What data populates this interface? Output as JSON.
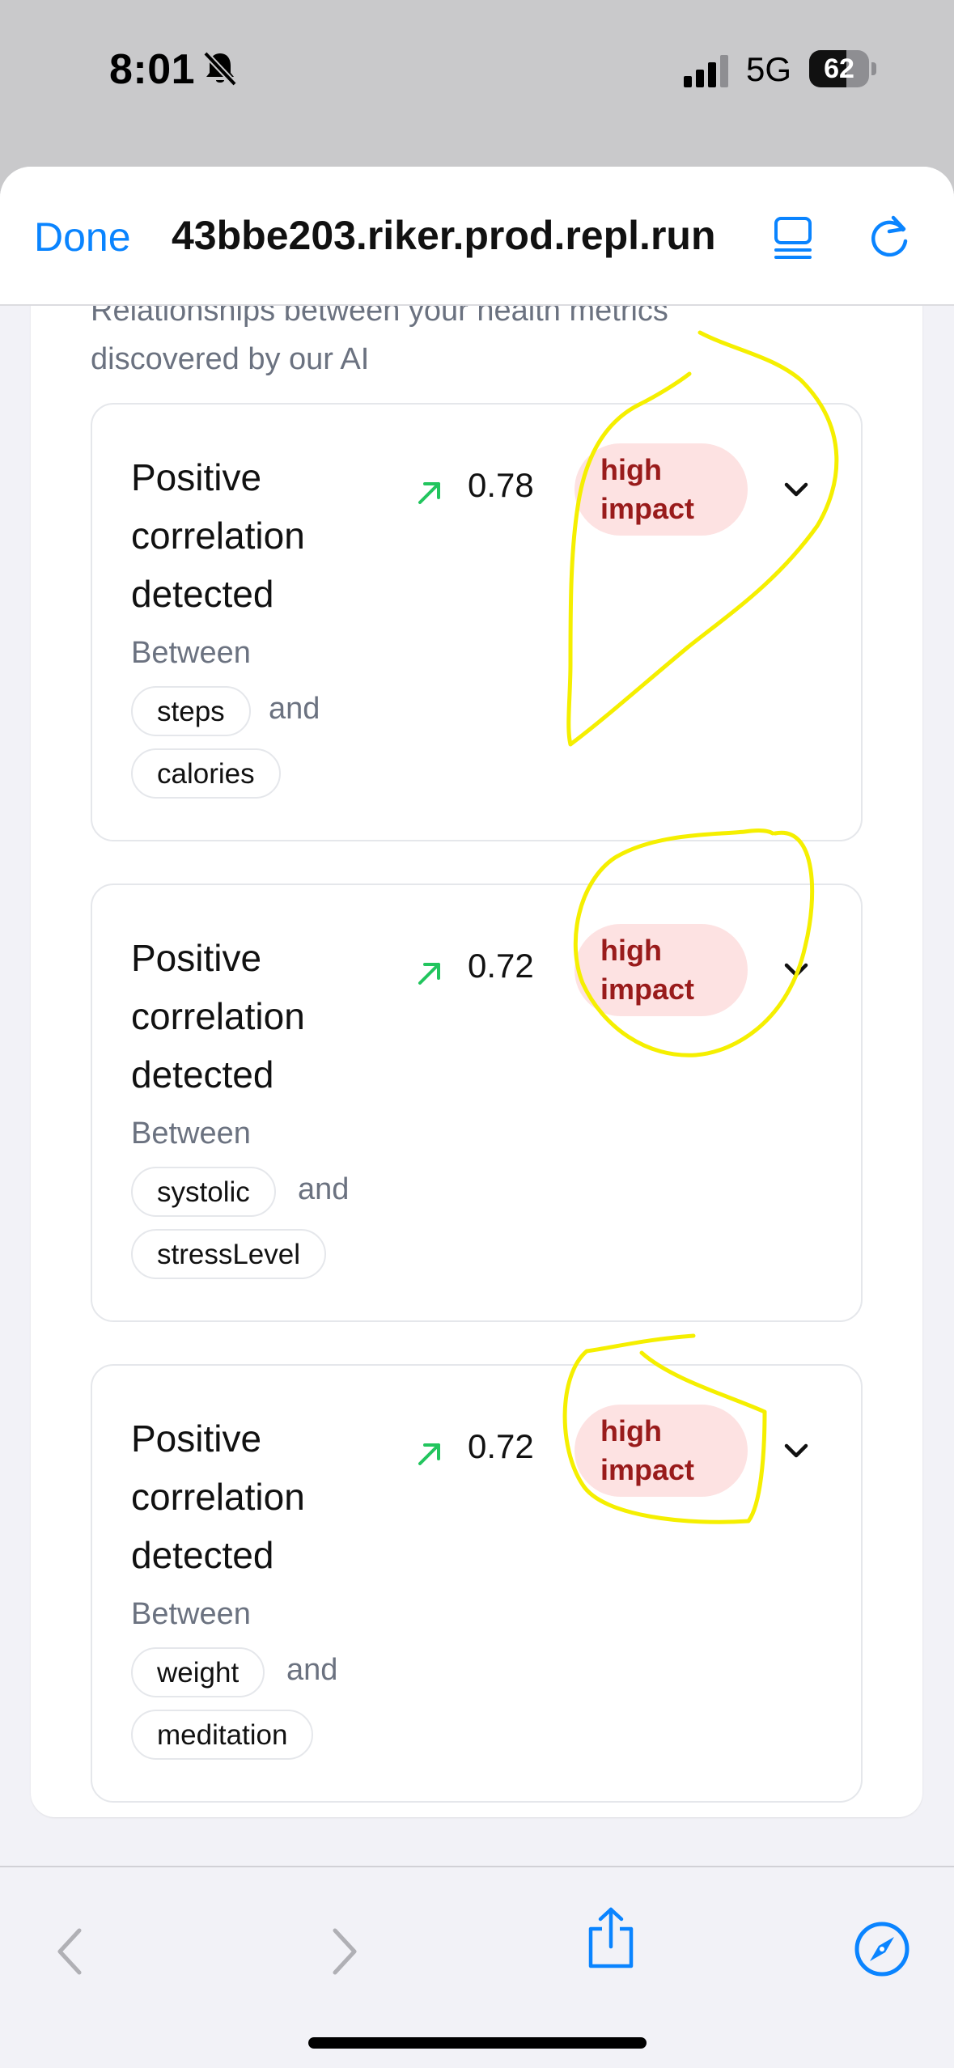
{
  "status_bar": {
    "time": "8:01",
    "network": "5G",
    "battery": "62",
    "battery_level": 0.62
  },
  "browser": {
    "done_label": "Done",
    "url": "43bbe203.riker.prod.repl.run"
  },
  "page": {
    "subtitle": "Relationships between your health metrics discovered by our AI",
    "insights": [
      {
        "title": "Positive correlation detected",
        "value": "0.78",
        "badge": "high impact",
        "between": "Between",
        "metric_a": "steps",
        "and": "and",
        "metric_b": "calories"
      },
      {
        "title": "Positive correlation detected",
        "value": "0.72",
        "badge": "high impact",
        "between": "Between",
        "metric_a": "systolic",
        "and": "and",
        "metric_b": "stressLevel"
      },
      {
        "title": "Positive correlation detected",
        "value": "0.72",
        "badge": "high impact",
        "between": "Between",
        "metric_a": "weight",
        "and": "and",
        "metric_b": "meditation"
      }
    ]
  },
  "colors": {
    "accent": "#0a84ff",
    "badge_bg": "#fde2e2",
    "badge_text": "#991b1b",
    "trend_up": "#22c55e",
    "annotation": "#f5ef00"
  }
}
